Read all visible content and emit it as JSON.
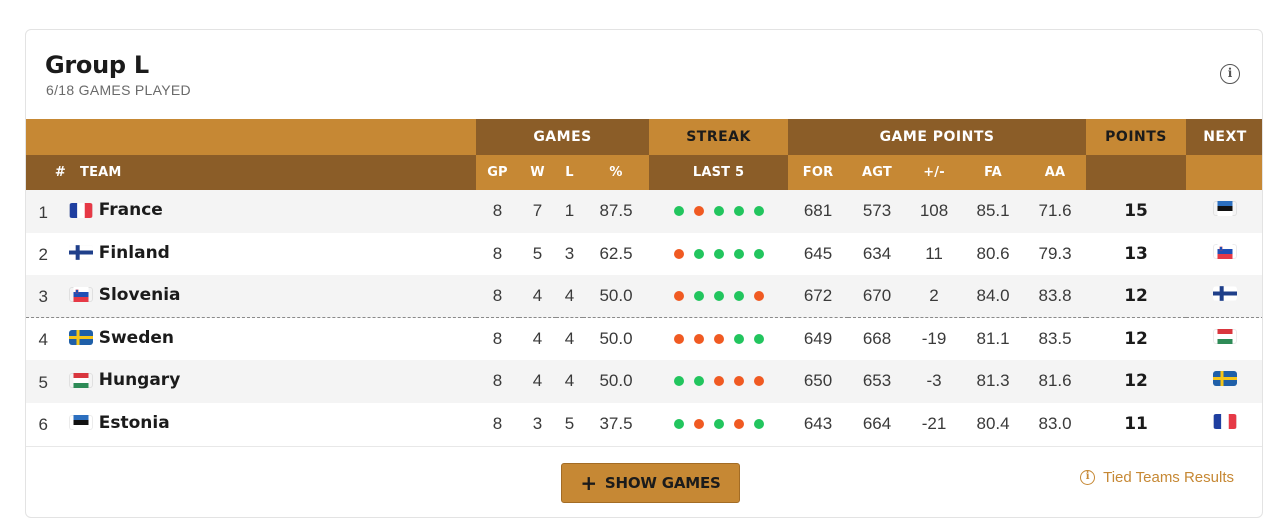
{
  "header": {
    "title": "Group L",
    "subtitle": "6/18 GAMES PLAYED",
    "info_icon": "info-icon"
  },
  "columns": {
    "groups": {
      "games": "GAMES",
      "streak": "STREAK",
      "game_points": "GAME POINTS",
      "points": "POINTS",
      "next": "NEXT"
    },
    "rank": "#",
    "team": "TEAM",
    "gp": "GP",
    "w": "W",
    "l": "L",
    "pct": "%",
    "last5": "LAST 5",
    "for": "FOR",
    "agt": "AGT",
    "diff": "+/-",
    "fa": "FA",
    "aa": "AA"
  },
  "colors": {
    "accent": "#c68834",
    "accent_dark": "#8b5d28",
    "win": "#22c55e",
    "loss": "#f05a22"
  },
  "rows": [
    {
      "rank": "1",
      "team": "France",
      "flag": "france",
      "gp": "8",
      "w": "7",
      "l": "1",
      "pct": "87.5",
      "streak": [
        "W",
        "L",
        "W",
        "W",
        "W"
      ],
      "for": "681",
      "agt": "573",
      "diff": "108",
      "fa": "85.1",
      "aa": "71.6",
      "points": "15",
      "next": "estonia"
    },
    {
      "rank": "2",
      "team": "Finland",
      "flag": "finland",
      "gp": "8",
      "w": "5",
      "l": "3",
      "pct": "62.5",
      "streak": [
        "L",
        "W",
        "W",
        "W",
        "W"
      ],
      "for": "645",
      "agt": "634",
      "diff": "11",
      "fa": "80.6",
      "aa": "79.3",
      "points": "13",
      "next": "slovenia"
    },
    {
      "rank": "3",
      "team": "Slovenia",
      "flag": "slovenia",
      "gp": "8",
      "w": "4",
      "l": "4",
      "pct": "50.0",
      "streak": [
        "L",
        "W",
        "W",
        "W",
        "L"
      ],
      "for": "672",
      "agt": "670",
      "diff": "2",
      "fa": "84.0",
      "aa": "83.8",
      "points": "12",
      "next": "finland"
    },
    {
      "rank": "4",
      "team": "Sweden",
      "flag": "sweden",
      "gp": "8",
      "w": "4",
      "l": "4",
      "pct": "50.0",
      "streak": [
        "L",
        "L",
        "L",
        "W",
        "W"
      ],
      "for": "649",
      "agt": "668",
      "diff": "-19",
      "fa": "81.1",
      "aa": "83.5",
      "points": "12",
      "next": "hungary"
    },
    {
      "rank": "5",
      "team": "Hungary",
      "flag": "hungary",
      "gp": "8",
      "w": "4",
      "l": "4",
      "pct": "50.0",
      "streak": [
        "W",
        "W",
        "L",
        "L",
        "L"
      ],
      "for": "650",
      "agt": "653",
      "diff": "-3",
      "fa": "81.3",
      "aa": "81.6",
      "points": "12",
      "next": "sweden"
    },
    {
      "rank": "6",
      "team": "Estonia",
      "flag": "estonia",
      "gp": "8",
      "w": "3",
      "l": "5",
      "pct": "37.5",
      "streak": [
        "W",
        "L",
        "W",
        "L",
        "W"
      ],
      "for": "643",
      "agt": "664",
      "diff": "-21",
      "fa": "80.4",
      "aa": "83.0",
      "points": "11",
      "next": "france"
    }
  ],
  "footer": {
    "show_games": "SHOW GAMES",
    "show_games_icon": "plus-icon",
    "tied_link": "Tied Teams Results",
    "tied_icon": "info-icon"
  }
}
